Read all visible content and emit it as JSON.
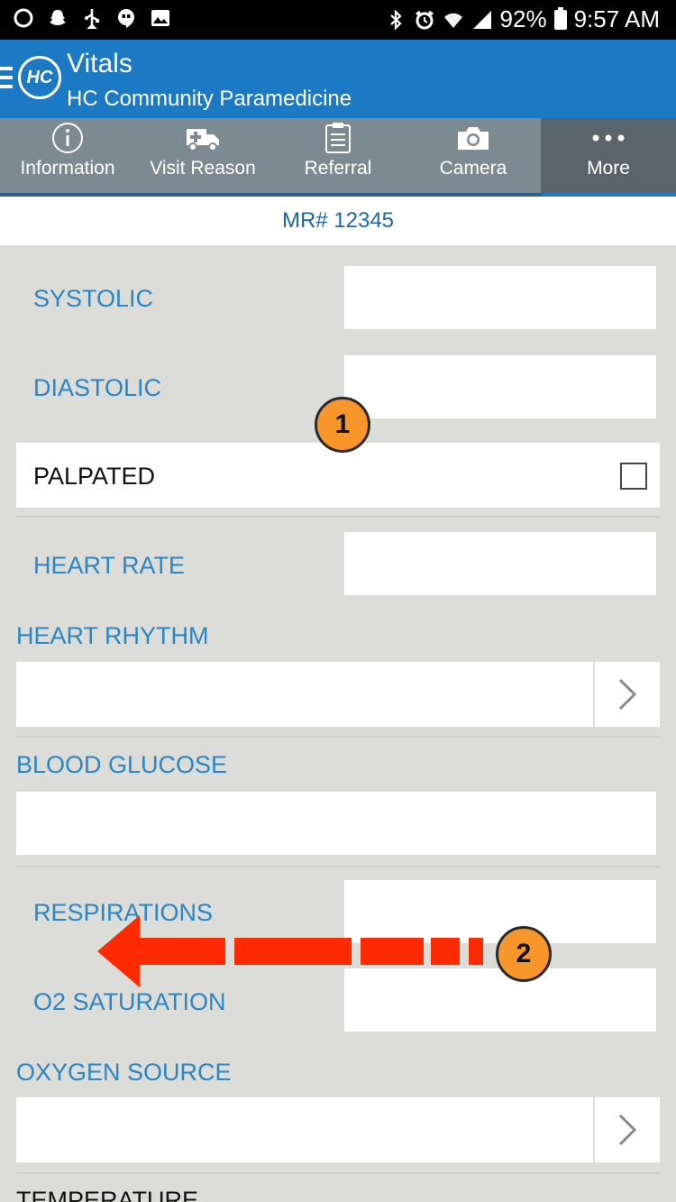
{
  "status_bar": {
    "battery": "92%",
    "time": "9:57 AM",
    "left_icons": [
      "circle-icon",
      "snapchat-icon",
      "usb-icon",
      "hangouts-icon",
      "image-icon"
    ],
    "right_icons": [
      "bluetooth-icon",
      "alarm-icon",
      "wifi-icon",
      "signal-icon",
      "battery-icon"
    ]
  },
  "header": {
    "logo_text": "HC",
    "title": "Vitals",
    "subtitle": "HC Community Paramedicine"
  },
  "tabs": [
    {
      "label": "Information",
      "icon": "info-icon"
    },
    {
      "label": "Visit Reason",
      "icon": "ambulance-icon"
    },
    {
      "label": "Referral",
      "icon": "clipboard-icon"
    },
    {
      "label": "Camera",
      "icon": "camera-icon"
    },
    {
      "label": "More",
      "icon": "more-icon",
      "active": true
    }
  ],
  "record": {
    "mr_number": "MR# 12345"
  },
  "form": {
    "systolic_label": "SYSTOLIC",
    "diastolic_label": "DIASTOLIC",
    "palpated_label": "PALPATED",
    "heart_rate_label": "HEART RATE",
    "heart_rhythm_label": "HEART RHYTHM",
    "blood_glucose_label": "BLOOD GLUCOSE",
    "respirations_label": "RESPIRATIONS",
    "o2_saturation_label": "O2 SATURATION",
    "oxygen_source_label": "OXYGEN SOURCE",
    "temperature_label": "TEMPERATURE"
  },
  "annotations": {
    "badge_1": "1",
    "badge_2": "2",
    "arrow_color": "#ff2a00"
  },
  "colors": {
    "header": "#1c7ac4",
    "tab_bar": "#7d8a92",
    "label": "#2a86c4",
    "badge": "#f7962a"
  }
}
